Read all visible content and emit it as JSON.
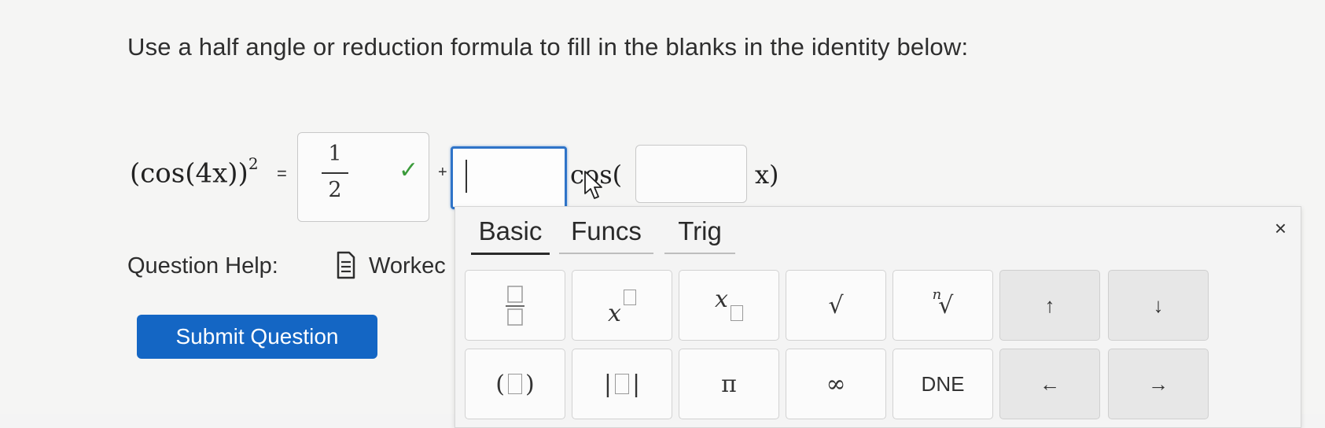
{
  "instruction": "Use a half angle or reduction formula to fill in the blanks in the identity below:",
  "equation": {
    "lhs": "(cos(4x))",
    "lhs_exponent": "2",
    "equals": "=",
    "answer1": {
      "numerator": "1",
      "denominator": "2",
      "status": "correct"
    },
    "plus": "+",
    "cos_label": "cos(",
    "tail": "x)"
  },
  "question_help": {
    "label": "Question Help:",
    "worked_label": "Workec"
  },
  "submit_label": "Submit Question",
  "palette": {
    "tabs": [
      "Basic",
      "Funcs",
      "Trig"
    ],
    "close": "×",
    "keys": {
      "up": "↑",
      "down": "↓",
      "pi": "π",
      "infinity": "∞",
      "dne": "DNE",
      "left": "←",
      "right": "→",
      "nth_root_index": "n",
      "sqrt_symbol": "√"
    }
  },
  "icons": [
    "check-icon",
    "document-icon",
    "close-icon",
    "mouse-cursor-icon"
  ],
  "colors": {
    "accent": "#1466c4",
    "focus": "#2f74c8",
    "correct": "#3b9b3b"
  }
}
